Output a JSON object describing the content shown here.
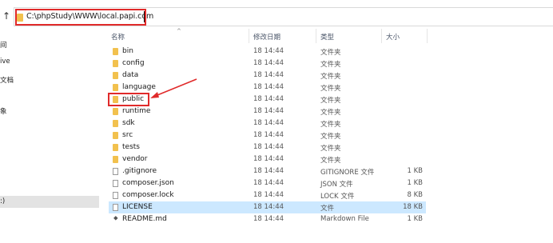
{
  "address": {
    "path": "C:\\phpStudy\\WWW\\local.papi.com"
  },
  "sidebar": {
    "items": [
      {
        "label": "间"
      },
      {
        "label": "ive"
      },
      {
        "label": "文档"
      },
      {
        "label": "象"
      },
      {
        "label": ":)"
      }
    ]
  },
  "columns": {
    "name": "名称",
    "date": "修改日期",
    "type": "类型",
    "size": "大小"
  },
  "files": [
    {
      "name": "bin",
      "date": "18 14:44",
      "type": "文件夹",
      "size": "",
      "kind": "folder"
    },
    {
      "name": "config",
      "date": "18 14:44",
      "type": "文件夹",
      "size": "",
      "kind": "folder"
    },
    {
      "name": "data",
      "date": "18 14:44",
      "type": "文件夹",
      "size": "",
      "kind": "folder"
    },
    {
      "name": "language",
      "date": "18 14:44",
      "type": "文件夹",
      "size": "",
      "kind": "folder"
    },
    {
      "name": "public",
      "date": "18 14:44",
      "type": "文件夹",
      "size": "",
      "kind": "folder"
    },
    {
      "name": "runtime",
      "date": "18 14:44",
      "type": "文件夹",
      "size": "",
      "kind": "folder"
    },
    {
      "name": "sdk",
      "date": "18 14:44",
      "type": "文件夹",
      "size": "",
      "kind": "folder"
    },
    {
      "name": "src",
      "date": "18 14:44",
      "type": "文件夹",
      "size": "",
      "kind": "folder"
    },
    {
      "name": "tests",
      "date": "18 14:44",
      "type": "文件夹",
      "size": "",
      "kind": "folder"
    },
    {
      "name": "vendor",
      "date": "18 14:44",
      "type": "文件夹",
      "size": "",
      "kind": "folder"
    },
    {
      "name": ".gitignore",
      "date": "18 14:44",
      "type": "GITIGNORE 文件",
      "size": "1 KB",
      "kind": "file"
    },
    {
      "name": "composer.json",
      "date": "18 14:44",
      "type": "JSON 文件",
      "size": "1 KB",
      "kind": "file"
    },
    {
      "name": "composer.lock",
      "date": "18 14:44",
      "type": "LOCK 文件",
      "size": "8 KB",
      "kind": "file"
    },
    {
      "name": "LICENSE",
      "date": "18 14:44",
      "type": "文件",
      "size": "18 KB",
      "kind": "file"
    },
    {
      "name": "README.md",
      "date": "18 14:44",
      "type": "Markdown File",
      "size": "1 KB",
      "kind": "md"
    }
  ],
  "colors": {
    "folder": "#f2c14e",
    "annotation": "#e02a2a",
    "selection": "#cce8ff"
  }
}
